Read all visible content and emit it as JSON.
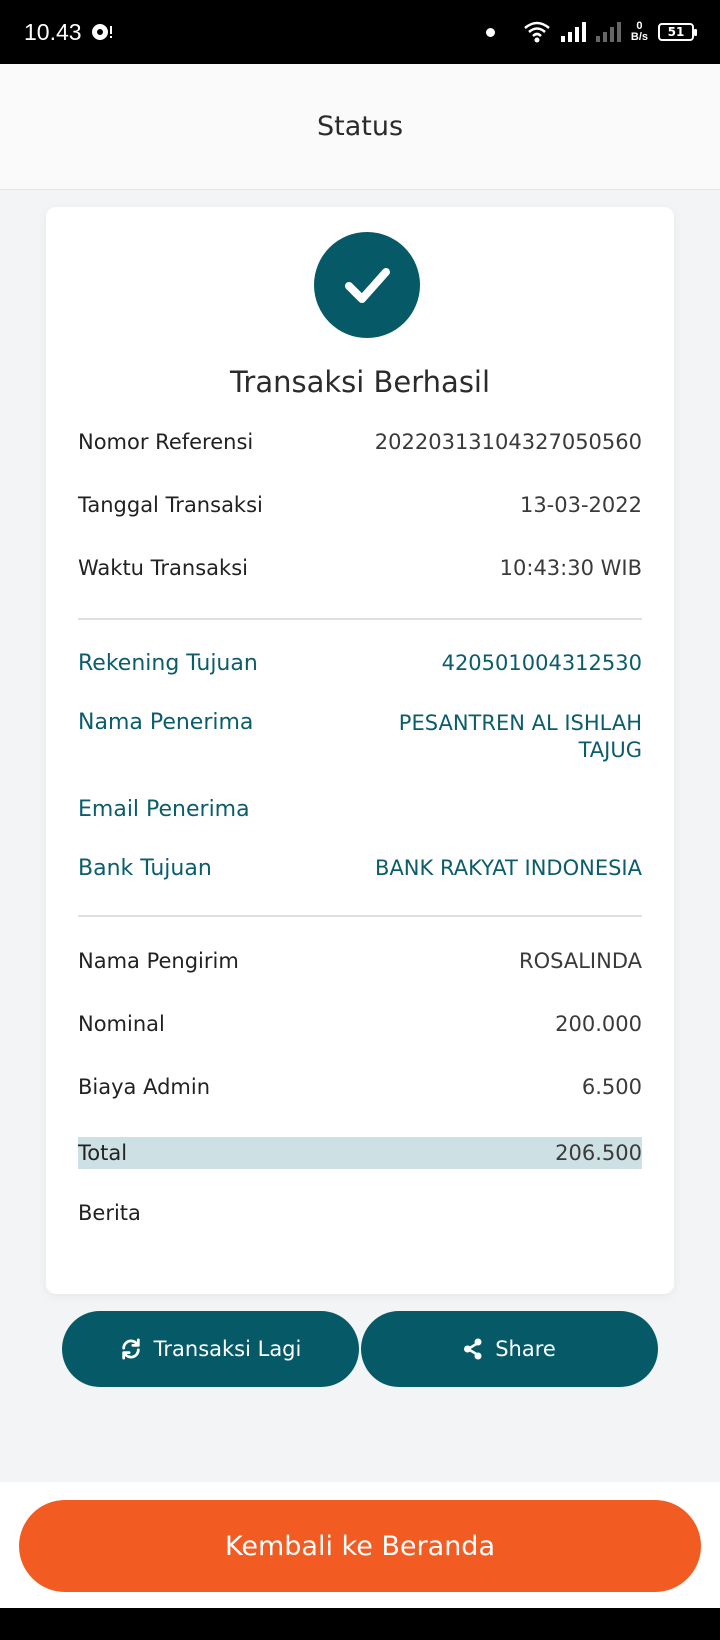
{
  "status_bar": {
    "time": "10.43",
    "net_speed_value": "0",
    "net_speed_unit": "B/s",
    "battery": "51"
  },
  "header": {
    "title": "Status"
  },
  "card": {
    "title": "Transaksi Berhasil",
    "details": [
      {
        "label": "Nomor Referensi",
        "value": "20220313104327050560"
      },
      {
        "label": "Tanggal Transaksi",
        "value": "13-03-2022"
      },
      {
        "label": "Waktu Transaksi",
        "value": "10:43:30 WIB"
      }
    ],
    "recipient": [
      {
        "label": "Rekening Tujuan",
        "value": "420501004312530"
      },
      {
        "label": "Nama Penerima",
        "value": "PESANTREN AL ISHLAH TAJUG"
      },
      {
        "label": "Email Penerima",
        "value": ""
      },
      {
        "label": "Bank Tujuan",
        "value": "BANK RAKYAT INDONESIA"
      }
    ],
    "sender": [
      {
        "label": "Nama Pengirim",
        "value": "ROSALINDA"
      },
      {
        "label": "Nominal",
        "value": "200.000"
      },
      {
        "label": "Biaya Admin",
        "value": "6.500"
      },
      {
        "label": "Total",
        "value": "206.500"
      },
      {
        "label": "Berita",
        "value": ""
      }
    ]
  },
  "actions": {
    "repeat_label": "Transaksi Lagi",
    "share_label": "Share",
    "home_label": "Kembali ke Beranda"
  },
  "colors": {
    "primary": "#065a68",
    "accent": "#f25c22",
    "total_highlight": "#cde0e3"
  }
}
